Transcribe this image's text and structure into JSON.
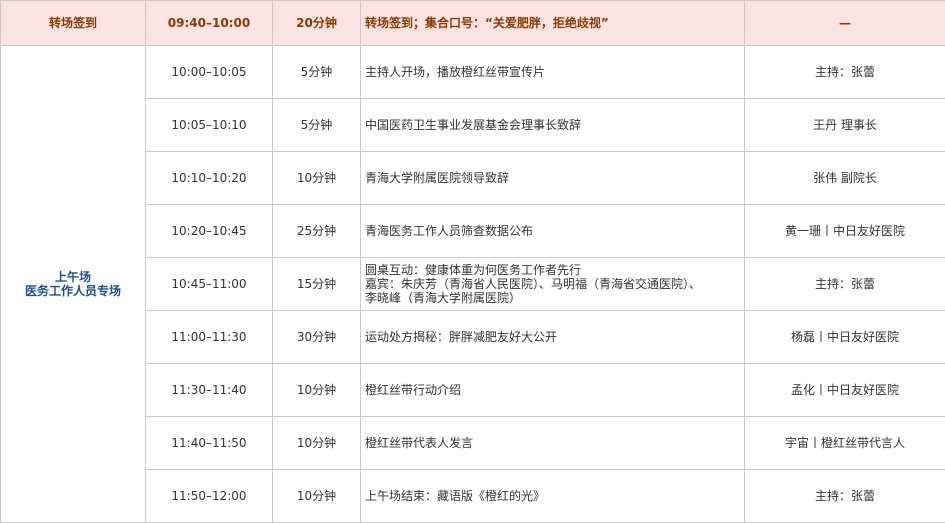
{
  "header": {
    "label": "转场签到",
    "time": "09:40–10:00",
    "duration": "20分钟",
    "content": "转场签到；集合口号：“关爱肥胖，拒绝歧视”",
    "person": "—"
  },
  "session": {
    "line1": "上午场",
    "line2": "医务工作人员专场"
  },
  "rows": [
    {
      "time": "10:00–10:05",
      "duration": "5分钟",
      "content": [
        "主持人开场，播放橙红丝带宣传片"
      ],
      "person": "主持：张蕾"
    },
    {
      "time": "10:05–10:10",
      "duration": "5分钟",
      "content": [
        "中国医药卫生事业发展基金会理事长致辞"
      ],
      "person": "王丹 理事长"
    },
    {
      "time": "10:10–10:20",
      "duration": "10分钟",
      "content": [
        "青海大学附属医院领导致辞"
      ],
      "person": "张伟 副院长"
    },
    {
      "time": "10:20–10:45",
      "duration": "25分钟",
      "content": [
        "青海医务工作人员筛查数据公布"
      ],
      "person": "黄一珊丨中日友好医院"
    },
    {
      "time": "10:45–11:00",
      "duration": "15分钟",
      "content": [
        "圆桌互动：健康体重为何医务工作者先行",
        "嘉宾：朱庆芳（青海省人民医院）、马明福（青海省交通医院）、",
        "李晓峰（青海大学附属医院）"
      ],
      "person": "主持：张蕾"
    },
    {
      "time": "11:00–11:30",
      "duration": "30分钟",
      "content": [
        "运动处方揭秘：胖胖减肥友好大公开"
      ],
      "person": "杨磊丨中日友好医院"
    },
    {
      "time": "11:30–11:40",
      "duration": "10分钟",
      "content": [
        "橙红丝带行动介绍"
      ],
      "person": "孟化丨中日友好医院"
    },
    {
      "time": "11:40–11:50",
      "duration": "10分钟",
      "content": [
        "橙红丝带代表人发言"
      ],
      "person": "宇宙丨橙红丝带代言人"
    },
    {
      "time": "11:50–12:00",
      "duration": "10分钟",
      "content": [
        "上午场结束：藏语版《橙红的光》"
      ],
      "person": "主持：张蕾"
    }
  ]
}
